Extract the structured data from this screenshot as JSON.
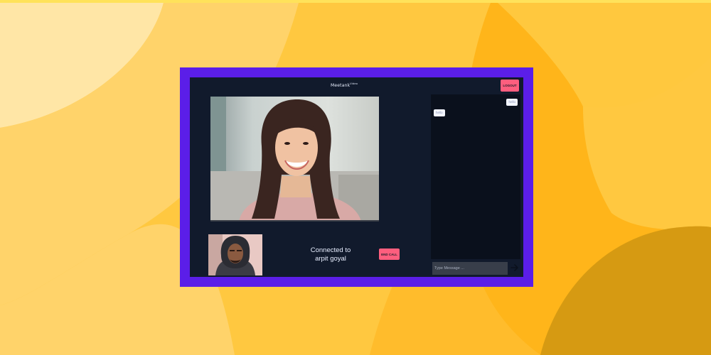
{
  "app": {
    "brand_name": "Meetank",
    "brand_suffix": "Video",
    "logout_label": "LOGOUT"
  },
  "call": {
    "status_line1": "Connected to",
    "status_line2": "arpit goyal",
    "end_call_label": "END CALL"
  },
  "chat": {
    "messages": [
      {
        "side": "right",
        "text": "hello"
      },
      {
        "side": "left",
        "text": "hello"
      }
    ],
    "input_placeholder": "Type Message ...",
    "send_icon": "arrow-right-icon"
  },
  "colors": {
    "background": "#FFC840",
    "frame_border": "#5B1EE8",
    "app_bg": "#111A2C",
    "chat_bg": "#0A101C",
    "accent_button": "#FF5E7E",
    "input_bg": "#383E4A"
  }
}
